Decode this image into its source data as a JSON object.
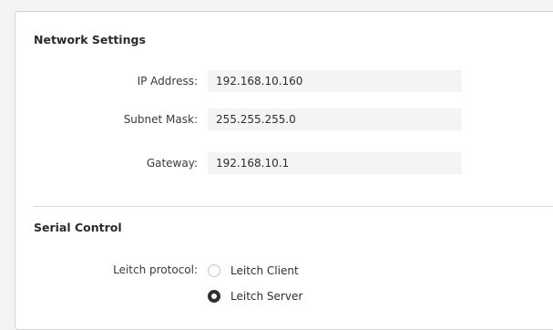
{
  "network": {
    "title": "Network Settings",
    "fields": [
      {
        "label": "IP Address:",
        "value": "192.168.10.160"
      },
      {
        "label": "Subnet Mask:",
        "value": "255.255.255.0"
      },
      {
        "label": "Gateway:",
        "value": "192.168.10.1"
      }
    ]
  },
  "serial": {
    "title": "Serial Control",
    "protocol_label": "Leitch protocol:",
    "options": [
      {
        "label": "Leitch Client",
        "selected": false
      },
      {
        "label": "Leitch Server",
        "selected": true
      }
    ]
  }
}
